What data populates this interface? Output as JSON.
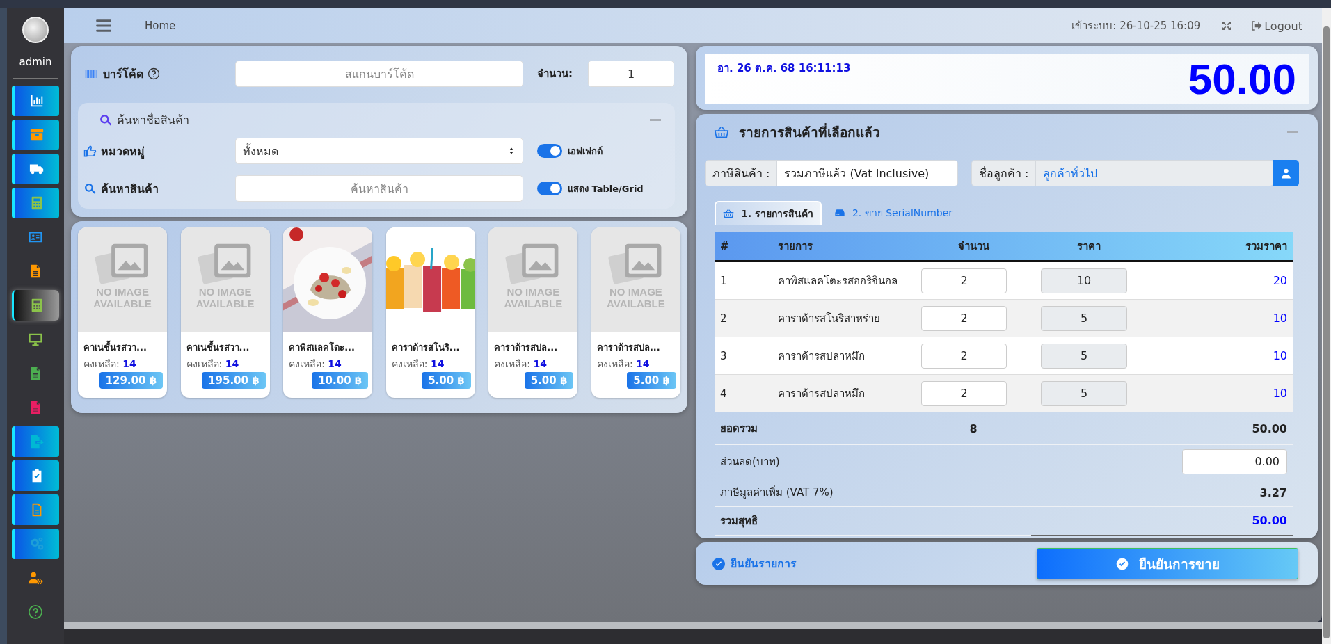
{
  "header": {
    "breadcrumb": "Home",
    "login_label": "เข้าระบบ:",
    "login_time": "26-10-25 16:09",
    "logout": "Logout"
  },
  "sidebar": {
    "user": "admin",
    "items": [
      {
        "kind": "tile",
        "selected": false
      },
      {
        "kind": "tile",
        "selected": false
      },
      {
        "kind": "tile",
        "selected": false
      },
      {
        "kind": "tile",
        "selected": false
      },
      {
        "kind": "plain",
        "selected": false
      },
      {
        "kind": "plain",
        "selected": false
      },
      {
        "kind": "plain",
        "selected": true
      },
      {
        "kind": "plain",
        "selected": false
      },
      {
        "kind": "plain",
        "selected": false
      },
      {
        "kind": "plain",
        "selected": false
      },
      {
        "kind": "tile",
        "selected": false
      },
      {
        "kind": "tile",
        "selected": false
      },
      {
        "kind": "tile",
        "selected": false
      },
      {
        "kind": "tile",
        "selected": false
      },
      {
        "kind": "plain",
        "selected": false
      },
      {
        "kind": "plain",
        "selected": false
      }
    ]
  },
  "search_panel": {
    "barcode_label": "บาร์โค้ด",
    "barcode": {
      "placeholder": "สแกนบาร์โค้ด"
    },
    "quantity_label": "จำนวน:",
    "quantity": "1",
    "section_title": "ค้นหาชื่อสินค้า",
    "category_label": "หมวดหมู่",
    "category": "ทั้งหมด",
    "effect_toggle": {
      "label": "เอฟเฟกต์",
      "on": true
    },
    "product_label": "ค้นหาสินค้า",
    "product_search": {
      "placeholder": "ค้นหาสินค้า"
    },
    "view_toggle": {
      "label": "แสดง Table/Grid",
      "on": true
    }
  },
  "products": [
    {
      "name": "คาเนชั้นรสวา...",
      "stock_label": "คงเหลือ:",
      "stock": "14",
      "price": "129.00 ฿",
      "image": {
        "kind": "placeholder",
        "text": "NO IMAGE AVAILABLE"
      }
    },
    {
      "name": "คาเนชั้นรสวา...",
      "stock_label": "คงเหลือ:",
      "stock": "14",
      "price": "195.00 ฿",
      "image": {
        "kind": "placeholder",
        "text": "NO IMAGE AVAILABLE"
      }
    },
    {
      "name": "คาพิสแลคโตะ...",
      "stock_label": "คงเหลือ:",
      "stock": "14",
      "price": "10.00 ฿"
    },
    {
      "name": "คาราด้ารสโนริ...",
      "stock_label": "คงเหลือ:",
      "stock": "14",
      "price": "5.00 ฿"
    },
    {
      "name": "คาราด้ารสปล...",
      "stock_label": "คงเหลือ:",
      "stock": "14",
      "price": "5.00 ฿",
      "image": {
        "kind": "placeholder",
        "text": "NO IMAGE AVAILABLE"
      }
    },
    {
      "name": "คาราด้ารสปล...",
      "stock_label": "คงเหลือ:",
      "stock": "14",
      "price": "5.00 ฿",
      "image": {
        "kind": "placeholder",
        "text": "NO IMAGE AVAILABLE"
      }
    }
  ],
  "display": {
    "datetime": "อา. 26 ต.ค. 68 16:11:13",
    "total": "50.00"
  },
  "cart": {
    "title": "รายการสินค้าที่เลือกแล้ว",
    "tax_label": "ภาษีสินค้า :",
    "tax_value": "รวมภาษีแล้ว (Vat Inclusive)",
    "customer_label": "ชื่อลูกค้า :",
    "customer_value": "ลูกค้าทั่วไป",
    "tabs": [
      {
        "label": "1. รายการสินค้า",
        "selected": true
      },
      {
        "label": "2. ขาย SerialNumber",
        "selected": false
      }
    ],
    "table": {
      "columns": [
        "#",
        "รายการ",
        "จำนวน",
        "ราคา",
        "รวมราคา"
      ],
      "rows": [
        {
          "no": "1",
          "name": "คาพิสแลคโตะรสออริจินอล",
          "quantity": "2",
          "price": "10",
          "total": "20"
        },
        {
          "no": "2",
          "name": "คาราด้ารสโนริสาหร่าย",
          "quantity": "2",
          "price": "5",
          "total": "10"
        },
        {
          "no": "3",
          "name": "คาราด้ารสปลาหมึก",
          "quantity": "2",
          "price": "5",
          "total": "10"
        },
        {
          "no": "4",
          "name": "คาราด้ารสปลาหมึก",
          "quantity": "2",
          "price": "5",
          "total": "10"
        }
      ]
    },
    "summary": {
      "total_label": "ยอดรวม",
      "total_quantity": "8",
      "total_amount": "50.00",
      "discount_label": "ส่วนลด(บาท)",
      "discount": "0.00",
      "vat_label": "ภาษีมูลค่าเพิ่ม (VAT 7%)",
      "vat": "3.27",
      "net_label": "รวมสุทธิ",
      "net": "50.00"
    }
  },
  "confirm": {
    "label": "ยืนยันรายการ",
    "checked": true,
    "button": "ยืนยันการขาย"
  }
}
